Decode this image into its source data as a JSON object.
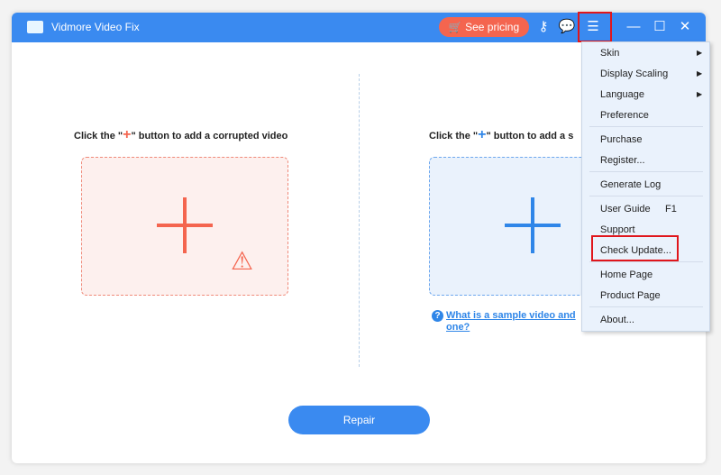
{
  "app": {
    "title": "Vidmore Video Fix",
    "see_pricing": "See pricing"
  },
  "left": {
    "prompt_pre": "Click the \"",
    "prompt_plus": "+",
    "prompt_post": "\" button to add a corrupted video",
    "accent": "#f4654f"
  },
  "right": {
    "prompt_pre": "Click the \"",
    "prompt_plus": "+",
    "prompt_post": "\" button to add a s",
    "accent": "#2f86e8",
    "link_line1": "What is a sample video and",
    "link_line2": "one?"
  },
  "repair_label": "Repair",
  "menu": {
    "items": [
      {
        "label": "Skin",
        "submenu": true
      },
      {
        "label": "Display Scaling",
        "submenu": true
      },
      {
        "label": "Language",
        "submenu": true
      },
      {
        "label": "Preference"
      },
      {
        "label": "Purchase"
      },
      {
        "label": "Register..."
      },
      {
        "label": "Generate Log"
      },
      {
        "label": "User Guide",
        "shortcut": "F1"
      },
      {
        "label": "Support"
      },
      {
        "label": "Check Update...",
        "highlighted": true
      },
      {
        "label": "Home Page"
      },
      {
        "label": "Product Page"
      },
      {
        "label": "About..."
      }
    ]
  }
}
